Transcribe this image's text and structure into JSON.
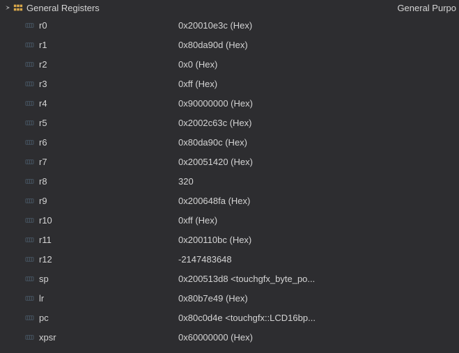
{
  "header": {
    "group_label": "General Registers",
    "right_label": "General Purpo"
  },
  "registers": [
    {
      "name": "r0",
      "value": "0x20010e3c (Hex)"
    },
    {
      "name": "r1",
      "value": "0x80da90d (Hex)"
    },
    {
      "name": "r2",
      "value": "0x0 (Hex)"
    },
    {
      "name": "r3",
      "value": "0xff (Hex)"
    },
    {
      "name": "r4",
      "value": "0x90000000 (Hex)"
    },
    {
      "name": "r5",
      "value": "0x2002c63c (Hex)"
    },
    {
      "name": "r6",
      "value": "0x80da90c (Hex)"
    },
    {
      "name": "r7",
      "value": "0x20051420 (Hex)"
    },
    {
      "name": "r8",
      "value": "320"
    },
    {
      "name": "r9",
      "value": "0x200648fa (Hex)"
    },
    {
      "name": "r10",
      "value": "0xff (Hex)"
    },
    {
      "name": "r11",
      "value": "0x200110bc (Hex)"
    },
    {
      "name": "r12",
      "value": "-2147483648"
    },
    {
      "name": "sp",
      "value": "0x200513d8 <touchgfx_byte_po..."
    },
    {
      "name": "lr",
      "value": "0x80b7e49 (Hex)"
    },
    {
      "name": "pc",
      "value": "0x80c0d4e <touchgfx::LCD16bp..."
    },
    {
      "name": "xpsr",
      "value": "0x60000000 (Hex)"
    }
  ]
}
